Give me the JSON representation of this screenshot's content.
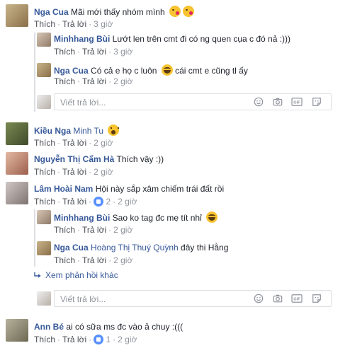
{
  "comments": [
    {
      "author": "Nga Cua",
      "text": "Mãi mới thấy nhóm mình",
      "like": "Thích",
      "reply": "Trả lời",
      "time": "3 giờ"
    },
    {
      "author": "Kiều Nga",
      "tag": "Minh Tu",
      "like": "Thích",
      "reply": "Trả lời",
      "time": "2 giờ"
    },
    {
      "author": "Nguyễn Thị Cẩm Hà",
      "text": "Thích vậy :))",
      "like": "Thích",
      "reply": "Trả lời",
      "time": "2 giờ"
    },
    {
      "author": "Lâm Hoài Nam",
      "text": "Hội này sắp xâm chiếm trái đất rồi",
      "like": "Thích",
      "reply": "Trả lời",
      "reactions": "2",
      "time": "2 giờ"
    },
    {
      "author": "Ann Bé",
      "text": "ai có sữa ms đc vào ả chuy :(((",
      "like": "Thích",
      "reply": "Trả lời",
      "reactions": "1",
      "time": "2 giờ"
    }
  ],
  "replies": [
    {
      "author": "Minhhang Bùi",
      "text": "Lướt len trên cmt đi có ng quen cụa c đó nả :)))",
      "like": "Thích",
      "reply": "Trả lời",
      "time": "3 giờ"
    },
    {
      "author": "Nga Cua",
      "text": "Có cả e họ c luôn",
      "text2": "cái cmt e cũng tl ấy",
      "like": "Thích",
      "reply": "Trả lời",
      "time": "2 giờ"
    },
    {
      "author": "Minhhang Bùi",
      "text": "Sao ko tag đc mẹ tít nhỉ",
      "like": "Thích",
      "reply": "Trả lời",
      "time": "2 giờ"
    },
    {
      "author": "Nga Cua",
      "tag": "Hoàng Thị Thuý Quỳnh",
      "text": "đây thi Hằng",
      "like": "Thích",
      "reply": "Trả lời",
      "time": "2 giờ"
    }
  ],
  "reply_box": {
    "placeholder": "Viết trả lời..."
  },
  "more_replies": "Xem phản hồi khác",
  "icons": [
    "emoji-icon",
    "camera-icon",
    "gif-icon",
    "sticker-icon"
  ],
  "colors": {
    "name": "#365899",
    "meta": "#90949c",
    "border": "#dddfe2",
    "like_blue": "#5890ff"
  }
}
